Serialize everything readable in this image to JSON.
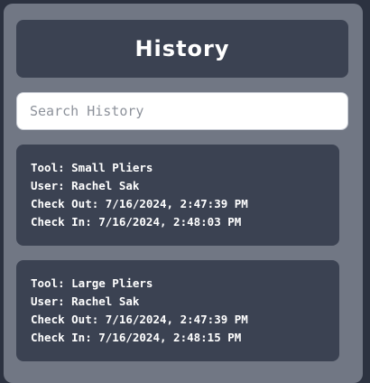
{
  "header": {
    "title": "History"
  },
  "search": {
    "placeholder": "Search History",
    "value": ""
  },
  "entries": [
    {
      "tool": "Tool: Small Pliers",
      "user": "User: Rachel Sak",
      "check_out": "Check Out: 7/16/2024, 2:47:39 PM",
      "check_in": "Check In: 7/16/2024, 2:48:03 PM"
    },
    {
      "tool": "Tool: Large Pliers",
      "user": "User: Rachel Sak",
      "check_out": "Check Out: 7/16/2024, 2:47:39 PM",
      "check_in": "Check In: 7/16/2024, 2:48:15 PM"
    }
  ],
  "colors": {
    "page_background": "#2c3240",
    "panel_background": "#717784",
    "card_background": "#3b4252",
    "text": "#ffffff"
  }
}
